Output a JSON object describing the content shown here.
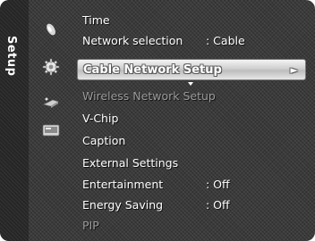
{
  "menu": {
    "title": "Setup",
    "category_icons": [
      "picture-icon",
      "setup-gear-icon",
      "input-icon",
      "application-icon"
    ],
    "items": [
      {
        "label": "Time",
        "value": "",
        "state": "normal"
      },
      {
        "label": "Network selection",
        "value": ": Cable",
        "state": "normal"
      },
      {
        "label": "Cable Network Setup",
        "value": "",
        "state": "selected",
        "arrow": "►"
      },
      {
        "label": "Wireless Network Setup",
        "value": "",
        "state": "disabled"
      },
      {
        "label": "V-Chip",
        "value": "",
        "state": "normal"
      },
      {
        "label": "Caption",
        "value": "",
        "state": "normal"
      },
      {
        "label": "External Settings",
        "value": "",
        "state": "normal"
      },
      {
        "label": "Entertainment",
        "value": ": Off",
        "state": "normal"
      },
      {
        "label": "Energy Saving",
        "value": ": Off",
        "state": "normal"
      },
      {
        "label": "PIP",
        "value": "",
        "state": "disabled"
      }
    ]
  },
  "colors": {
    "panel_bg": "#3a3a3a",
    "highlight": "#cfcfcf",
    "text": "#ffffff",
    "disabled_text": "#9a9a9a"
  }
}
